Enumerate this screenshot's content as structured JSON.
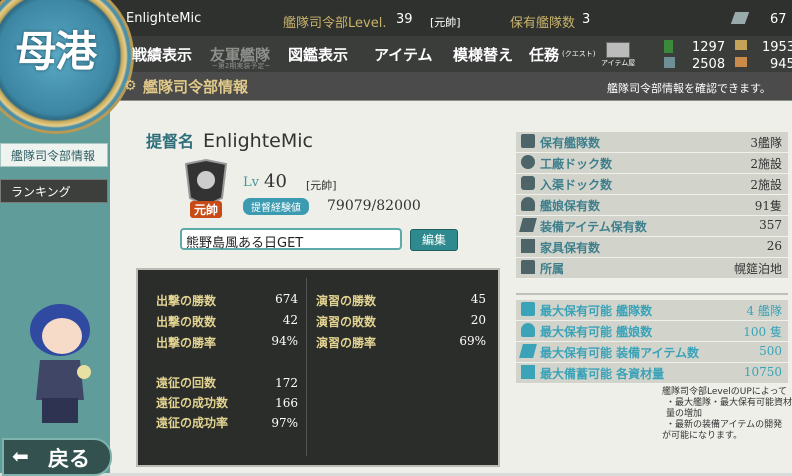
{
  "port": {
    "label": "母港"
  },
  "top": {
    "admiral_name": "EnlighteMic",
    "level_label": "艦隊司令部Level.",
    "level_value": "39",
    "rank": "[元帥]",
    "ships_label": "保有艦隊数",
    "ships_value": "3",
    "devmat": "67"
  },
  "nav": {
    "items": [
      {
        "label": "戦績表示",
        "sub": ""
      },
      {
        "label": "友軍艦隊",
        "sub": "~第2期実装予定~"
      },
      {
        "label": "図鑑表示",
        "sub": ""
      },
      {
        "label": "アイテム",
        "sub": ""
      },
      {
        "label": "模様替え",
        "sub": ""
      },
      {
        "label": "任務",
        "sub": "(クエスト)"
      }
    ],
    "shop_label": "アイテム屋"
  },
  "resources": {
    "fuel": "1297",
    "steel": "2508",
    "ammo": "1953",
    "bauxite": "945"
  },
  "subheader": {
    "title": "艦隊司令部情報",
    "hint": "艦隊司令部情報を確認できます。"
  },
  "side": {
    "items": [
      "艦隊司令部情報",
      "ランキング"
    ]
  },
  "back": {
    "label": "戻る"
  },
  "profile": {
    "name_label": "提督名",
    "name": "EnlighteMic",
    "lv_label": "Lv",
    "lv": "40",
    "rank": "[元帥]",
    "exp_label": "提督経験値",
    "exp": "79079/82000",
    "comment": "熊野島風ある日GET",
    "edit_label": "編集",
    "rank_badge": "元帥"
  },
  "stats": {
    "sortie": [
      {
        "label": "出撃の勝数",
        "value": "674"
      },
      {
        "label": "出撃の敗数",
        "value": "42"
      },
      {
        "label": "出撃の勝率",
        "value": "94%"
      }
    ],
    "exercise": [
      {
        "label": "演習の勝数",
        "value": "45"
      },
      {
        "label": "演習の敗数",
        "value": "20"
      },
      {
        "label": "演習の勝率",
        "value": "69%"
      }
    ],
    "expedition": [
      {
        "label": "遠征の回数",
        "value": "172"
      },
      {
        "label": "遠征の成功数",
        "value": "166"
      },
      {
        "label": "遠征の成功率",
        "value": "97%"
      }
    ]
  },
  "info": [
    {
      "label": "保有艦隊数",
      "value": "3艦隊",
      "icon": "fleet-icon"
    },
    {
      "label": "工廠ドック数",
      "value": "2施設",
      "icon": "gear-icon"
    },
    {
      "label": "入渠ドック数",
      "value": "2施設",
      "icon": "repair-icon"
    },
    {
      "label": "艦娘保有数",
      "value": "91隻",
      "icon": "girl-icon"
    },
    {
      "label": "装備アイテム保有数",
      "value": "357",
      "icon": "equip-icon"
    },
    {
      "label": "家具保有数",
      "value": "26",
      "icon": "furniture-icon"
    },
    {
      "label": "所属",
      "value": "幌筵泊地",
      "icon": "base-icon"
    }
  ],
  "max": [
    {
      "label": "最大保有可能 艦隊数",
      "value": "4 艦隊",
      "icon": "fleet-icon"
    },
    {
      "label": "最大保有可能 艦娘数",
      "value": "100 隻",
      "icon": "girl-icon"
    },
    {
      "label": "最大保有可能 装備アイテム数",
      "value": "500",
      "icon": "equip-icon"
    },
    {
      "label": "最大備蓄可能 各資材量",
      "value": "10750",
      "icon": "storage-icon"
    }
  ],
  "note": [
    "艦隊司令部LevelのUPによって",
    "・最大艦隊・最大保有可能資材量の増加",
    "・最新の装備アイテムの開発",
    "が可能になります。"
  ],
  "colors": {
    "accent_gold": "#c9b36a",
    "teal": "#3f7f8c",
    "dark_panel": "#2b2d2a"
  }
}
